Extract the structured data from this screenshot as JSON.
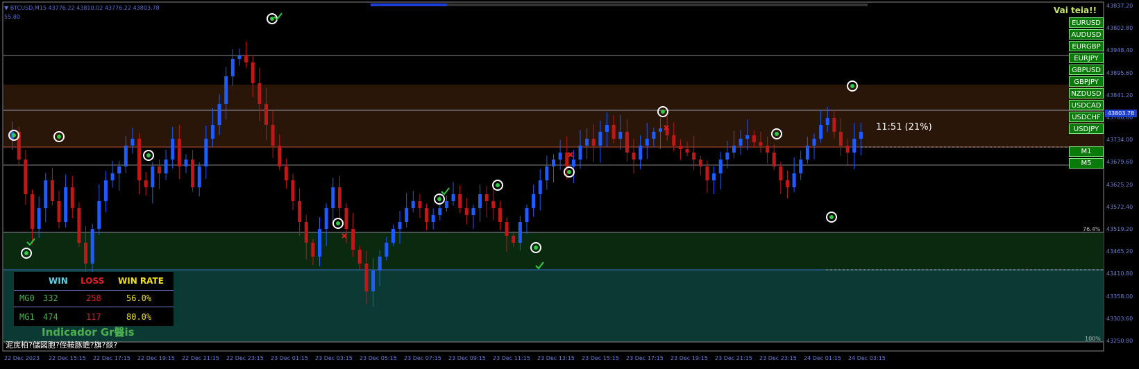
{
  "header": {
    "symbol_line": "▼ BTCUSD,M15  43776.22 43810.02 43776.22 43803.78",
    "sub_value": "55.80"
  },
  "overlay": {
    "vai_teia": "Vai teia!!",
    "timer": "11:51 (21%)"
  },
  "symbol_buttons": [
    "EURUSD",
    "AUDUSD",
    "EURGBP",
    "EURJPY",
    "GBPUSD",
    "GBPJPY",
    "NZDUSD",
    "USDCAD",
    "USDCHF",
    "USDJPY"
  ],
  "timeframe_buttons": [
    "M1",
    "M5"
  ],
  "price_axis": [
    "43837.20",
    "43802.80",
    "43948.40",
    "43895.60",
    "43841.20",
    "43786.80",
    "43734.00",
    "43679.60",
    "43625.20",
    "43572.40",
    "43519.20",
    "43465.20",
    "43410.80",
    "43358.00",
    "43303.60",
    "43250.80"
  ],
  "current_price": "43803.78",
  "time_axis": [
    "22 Dec 2023",
    "22 Dec 15:15",
    "22 Dec 17:15",
    "22 Dec 19:15",
    "22 Dec 21:15",
    "22 Dec 23:15",
    "23 Dec 01:15",
    "23 Dec 03:15",
    "23 Dec 05:15",
    "23 Dec 07:15",
    "23 Dec 09:15",
    "23 Dec 11:15",
    "23 Dec 13:15",
    "23 Dec 15:15",
    "23 Dec 17:15",
    "23 Dec 19:15",
    "23 Dec 21:15",
    "23 Dec 23:15",
    "24 Dec 01:15",
    "24 Dec 03:15"
  ],
  "fib_labels": [
    "76.4%",
    "100%"
  ],
  "stats": {
    "headers": [
      "WIN",
      "LOSS",
      "WIN RATE"
    ],
    "rows": [
      {
        "label": "MG0",
        "win": "332",
        "loss": "258",
        "rate": "56.0%"
      },
      {
        "label": "MG1",
        "win": "474",
        "loss": "117",
        "rate": "80.0%"
      }
    ]
  },
  "indicator_title": "Indicador Gr醫is",
  "garbled_line": "泥庑柏?儲図胞?侄鞍豚蟾?旗?燚?",
  "colors": {
    "bull": "#1e5cff",
    "bear": "#c01818",
    "brown_zone": "#2a1608",
    "green_zone": "#0a2a10",
    "teal_zone": "#0b3a34",
    "axis_text": "#6b7dd8"
  },
  "icons": {
    "signal_marker": "target-icon",
    "win_mark": "checkmark-icon",
    "loss_mark": "cross-icon"
  }
}
